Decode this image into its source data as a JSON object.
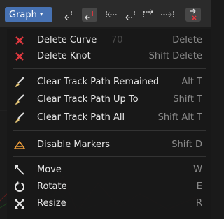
{
  "header": {
    "graph_tab": "Graph",
    "icons": [
      "jump-to-start-icon",
      "jump-to-prev-marker-icon",
      "track-backward-icon",
      "track-backward-frame-icon",
      "track-forward-frame-icon",
      "track-forward-icon",
      "jump-to-end-icon"
    ]
  },
  "menu": {
    "items": [
      {
        "label": "Delete Curve",
        "shortcut": "Delete",
        "icon": "x-icon"
      },
      {
        "label": "Delete Knot",
        "shortcut": "Shift Delete",
        "icon": "x-icon"
      },
      {
        "label": "Clear Track Path Remained",
        "shortcut": "Alt T",
        "icon": "brush-icon"
      },
      {
        "label": "Clear Track Path Up To",
        "shortcut": "Shift T",
        "icon": "brush-icon"
      },
      {
        "label": "Clear Track Path All",
        "shortcut": "Shift Alt T",
        "icon": "brush-icon"
      },
      {
        "label": "Disable Markers",
        "shortcut": "Shift D",
        "icon": "marker-icon"
      },
      {
        "label": "Move",
        "shortcut": "W",
        "icon": "move-icon"
      },
      {
        "label": "Rotate",
        "shortcut": "E",
        "icon": "rotate-icon"
      },
      {
        "label": "Resize",
        "shortcut": "R",
        "icon": "resize-icon"
      }
    ],
    "bg_text": "70"
  },
  "colors": {
    "accent": "#4772b3",
    "delete_red": "#e0383f",
    "marker_orange": "#e89a3a"
  }
}
